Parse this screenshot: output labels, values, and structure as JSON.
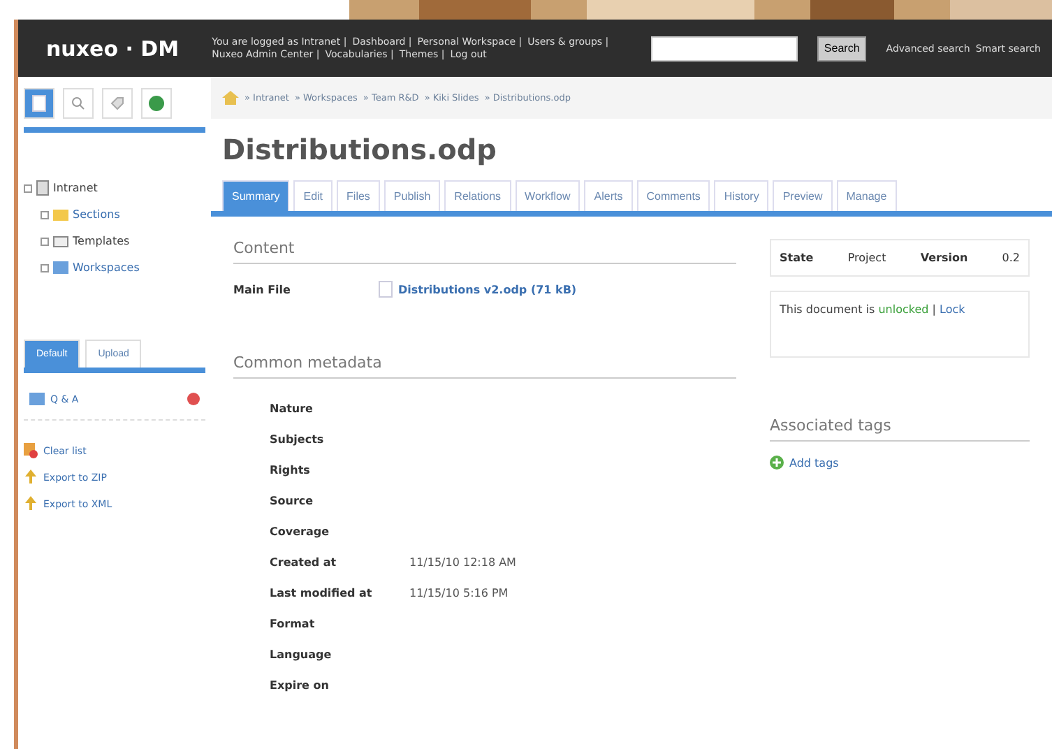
{
  "header": {
    "logo": "nuxeo · DM",
    "user_links": [
      "You are logged as Intranet |",
      "Dashboard |",
      "Personal Workspace |",
      "Users & groups |",
      "Nuxeo Admin Center |",
      "Vocabularies |",
      "Themes |",
      "Log out"
    ],
    "search": {
      "button": "Search"
    },
    "search_links": [
      "Advanced search",
      "Smart search"
    ]
  },
  "sidebar": {
    "icon_tabs": [
      {
        "kind": "document",
        "selected": true
      },
      {
        "kind": "search",
        "selected": false
      },
      {
        "kind": "tag",
        "selected": false
      },
      {
        "kind": "globe",
        "selected": false
      }
    ],
    "tree": [
      {
        "label": "Intranet",
        "kind": "server",
        "children": [
          {
            "label": "Sections",
            "kind": "folder"
          },
          {
            "label": "Templates",
            "kind": "template"
          },
          {
            "label": "Workspaces",
            "kind": "workspace"
          }
        ]
      }
    ],
    "list_tabs": [
      {
        "label": "Default",
        "selected": true
      },
      {
        "label": "Upload",
        "selected": false
      }
    ],
    "list_items": [
      "Q & A"
    ],
    "actions": [
      {
        "label": "Clear list",
        "kind": "clear"
      },
      {
        "label": "Export to ZIP",
        "kind": "export"
      },
      {
        "label": "Export to XML",
        "kind": "export"
      }
    ]
  },
  "breadcrumb": [
    "» Intranet",
    "» Workspaces",
    "» Team R&D",
    "» Kiki Slides",
    "» Distributions.odp"
  ],
  "title": "Distributions.odp",
  "tabs": [
    {
      "label": "Summary",
      "selected": true
    },
    {
      "label": "Edit",
      "selected": false
    },
    {
      "label": "Files",
      "selected": false
    },
    {
      "label": "Publish",
      "selected": false
    },
    {
      "label": "Relations",
      "selected": false
    },
    {
      "label": "Workflow",
      "selected": false
    },
    {
      "label": "Alerts",
      "selected": false
    },
    {
      "label": "Comments",
      "selected": false
    },
    {
      "label": "History",
      "selected": false
    },
    {
      "label": "Preview",
      "selected": false
    },
    {
      "label": "Manage",
      "selected": false
    }
  ],
  "content": {
    "heading": "Content",
    "main_file_label": "Main File",
    "main_file": "Distributions v2.odp (71 kB)"
  },
  "metadata": {
    "heading": "Common metadata",
    "fields": [
      {
        "label": "Nature"
      },
      {
        "label": "Subjects"
      },
      {
        "label": "Rights"
      },
      {
        "label": "Source"
      },
      {
        "label": "Coverage"
      },
      {
        "label": "Created at",
        "value": "11/15/10 12:18 AM"
      },
      {
        "label": "Last modified at",
        "value": "11/15/10 5:16 PM"
      },
      {
        "label": "Format"
      },
      {
        "label": "Language"
      },
      {
        "label": "Expire on"
      }
    ]
  },
  "status": {
    "state_label": "State",
    "state": "Project",
    "version_label": "Version",
    "version": "0.2"
  },
  "lock": {
    "text": "This document is",
    "status": "unlocked",
    "separator": "|",
    "link": "Lock"
  },
  "tags": {
    "heading": "Associated tags",
    "add": "Add tags"
  }
}
